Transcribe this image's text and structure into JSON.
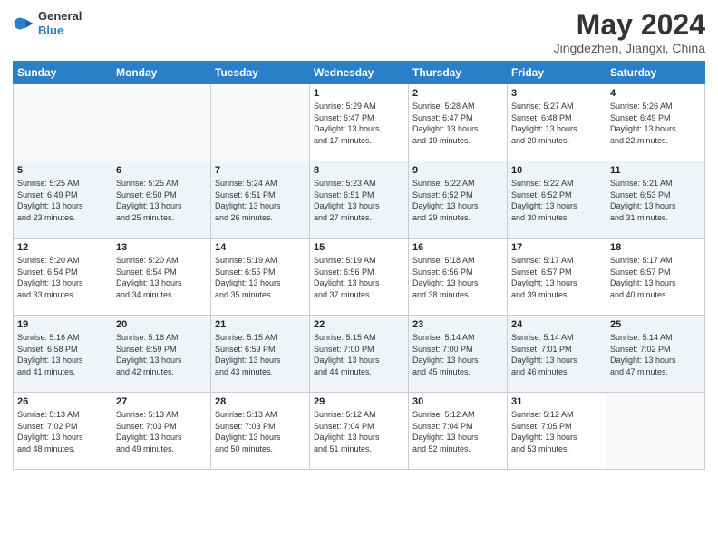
{
  "logo": {
    "general": "General",
    "blue": "Blue"
  },
  "header": {
    "month": "May 2024",
    "location": "Jingdezhen, Jiangxi, China"
  },
  "days_of_week": [
    "Sunday",
    "Monday",
    "Tuesday",
    "Wednesday",
    "Thursday",
    "Friday",
    "Saturday"
  ],
  "weeks": [
    [
      {
        "day": "",
        "info": ""
      },
      {
        "day": "",
        "info": ""
      },
      {
        "day": "",
        "info": ""
      },
      {
        "day": "1",
        "info": "Sunrise: 5:29 AM\nSunset: 6:47 PM\nDaylight: 13 hours\nand 17 minutes."
      },
      {
        "day": "2",
        "info": "Sunrise: 5:28 AM\nSunset: 6:47 PM\nDaylight: 13 hours\nand 19 minutes."
      },
      {
        "day": "3",
        "info": "Sunrise: 5:27 AM\nSunset: 6:48 PM\nDaylight: 13 hours\nand 20 minutes."
      },
      {
        "day": "4",
        "info": "Sunrise: 5:26 AM\nSunset: 6:49 PM\nDaylight: 13 hours\nand 22 minutes."
      }
    ],
    [
      {
        "day": "5",
        "info": "Sunrise: 5:25 AM\nSunset: 6:49 PM\nDaylight: 13 hours\nand 23 minutes."
      },
      {
        "day": "6",
        "info": "Sunrise: 5:25 AM\nSunset: 6:50 PM\nDaylight: 13 hours\nand 25 minutes."
      },
      {
        "day": "7",
        "info": "Sunrise: 5:24 AM\nSunset: 6:51 PM\nDaylight: 13 hours\nand 26 minutes."
      },
      {
        "day": "8",
        "info": "Sunrise: 5:23 AM\nSunset: 6:51 PM\nDaylight: 13 hours\nand 27 minutes."
      },
      {
        "day": "9",
        "info": "Sunrise: 5:22 AM\nSunset: 6:52 PM\nDaylight: 13 hours\nand 29 minutes."
      },
      {
        "day": "10",
        "info": "Sunrise: 5:22 AM\nSunset: 6:52 PM\nDaylight: 13 hours\nand 30 minutes."
      },
      {
        "day": "11",
        "info": "Sunrise: 5:21 AM\nSunset: 6:53 PM\nDaylight: 13 hours\nand 31 minutes."
      }
    ],
    [
      {
        "day": "12",
        "info": "Sunrise: 5:20 AM\nSunset: 6:54 PM\nDaylight: 13 hours\nand 33 minutes."
      },
      {
        "day": "13",
        "info": "Sunrise: 5:20 AM\nSunset: 6:54 PM\nDaylight: 13 hours\nand 34 minutes."
      },
      {
        "day": "14",
        "info": "Sunrise: 5:19 AM\nSunset: 6:55 PM\nDaylight: 13 hours\nand 35 minutes."
      },
      {
        "day": "15",
        "info": "Sunrise: 5:19 AM\nSunset: 6:56 PM\nDaylight: 13 hours\nand 37 minutes."
      },
      {
        "day": "16",
        "info": "Sunrise: 5:18 AM\nSunset: 6:56 PM\nDaylight: 13 hours\nand 38 minutes."
      },
      {
        "day": "17",
        "info": "Sunrise: 5:17 AM\nSunset: 6:57 PM\nDaylight: 13 hours\nand 39 minutes."
      },
      {
        "day": "18",
        "info": "Sunrise: 5:17 AM\nSunset: 6:57 PM\nDaylight: 13 hours\nand 40 minutes."
      }
    ],
    [
      {
        "day": "19",
        "info": "Sunrise: 5:16 AM\nSunset: 6:58 PM\nDaylight: 13 hours\nand 41 minutes."
      },
      {
        "day": "20",
        "info": "Sunrise: 5:16 AM\nSunset: 6:59 PM\nDaylight: 13 hours\nand 42 minutes."
      },
      {
        "day": "21",
        "info": "Sunrise: 5:15 AM\nSunset: 6:59 PM\nDaylight: 13 hours\nand 43 minutes."
      },
      {
        "day": "22",
        "info": "Sunrise: 5:15 AM\nSunset: 7:00 PM\nDaylight: 13 hours\nand 44 minutes."
      },
      {
        "day": "23",
        "info": "Sunrise: 5:14 AM\nSunset: 7:00 PM\nDaylight: 13 hours\nand 45 minutes."
      },
      {
        "day": "24",
        "info": "Sunrise: 5:14 AM\nSunset: 7:01 PM\nDaylight: 13 hours\nand 46 minutes."
      },
      {
        "day": "25",
        "info": "Sunrise: 5:14 AM\nSunset: 7:02 PM\nDaylight: 13 hours\nand 47 minutes."
      }
    ],
    [
      {
        "day": "26",
        "info": "Sunrise: 5:13 AM\nSunset: 7:02 PM\nDaylight: 13 hours\nand 48 minutes."
      },
      {
        "day": "27",
        "info": "Sunrise: 5:13 AM\nSunset: 7:03 PM\nDaylight: 13 hours\nand 49 minutes."
      },
      {
        "day": "28",
        "info": "Sunrise: 5:13 AM\nSunset: 7:03 PM\nDaylight: 13 hours\nand 50 minutes."
      },
      {
        "day": "29",
        "info": "Sunrise: 5:12 AM\nSunset: 7:04 PM\nDaylight: 13 hours\nand 51 minutes."
      },
      {
        "day": "30",
        "info": "Sunrise: 5:12 AM\nSunset: 7:04 PM\nDaylight: 13 hours\nand 52 minutes."
      },
      {
        "day": "31",
        "info": "Sunrise: 5:12 AM\nSunset: 7:05 PM\nDaylight: 13 hours\nand 53 minutes."
      },
      {
        "day": "",
        "info": ""
      }
    ]
  ]
}
